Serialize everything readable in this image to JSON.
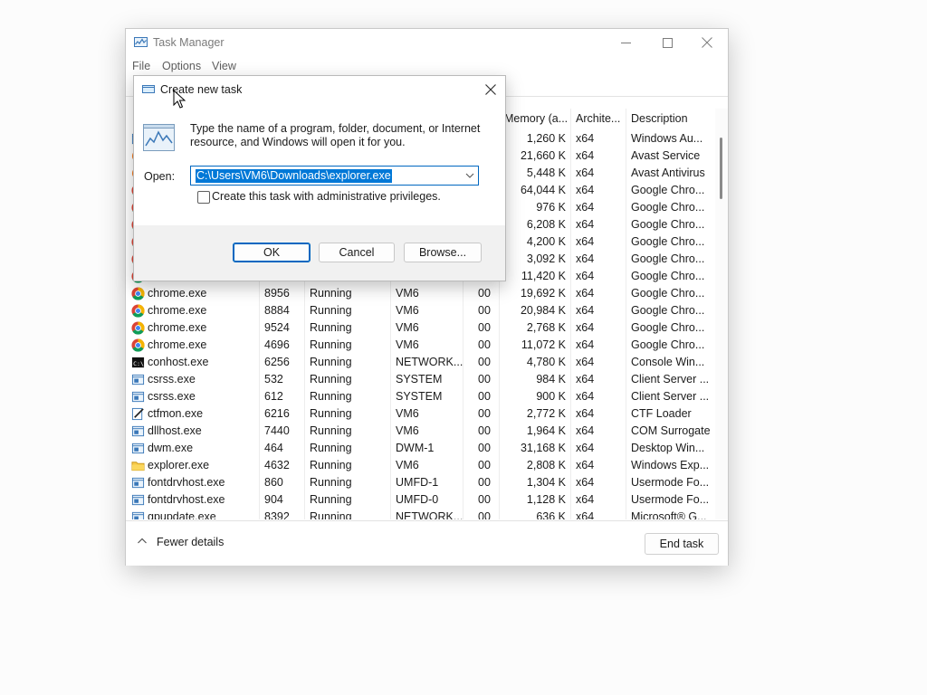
{
  "task_manager": {
    "title": "Task Manager",
    "icon": "task-manager-chart-icon",
    "menu": [
      "File",
      "Options",
      "View"
    ],
    "columns": [
      "Memory (a...",
      "Archite...",
      "Description"
    ],
    "rows": [
      {
        "name": "",
        "pid": "",
        "status": "",
        "user": "",
        "cpu": "",
        "memory": "1,260 K",
        "arch": "x64",
        "desc": "Windows Au...",
        "icon": "window-icon"
      },
      {
        "name": "",
        "pid": "",
        "status": "",
        "user": "",
        "cpu": "",
        "memory": "21,660 K",
        "arch": "x64",
        "desc": "Avast Service",
        "icon": "avast-icon"
      },
      {
        "name": "",
        "pid": "",
        "status": "",
        "user": "",
        "cpu": "",
        "memory": "5,448 K",
        "arch": "x64",
        "desc": "Avast Antivirus",
        "icon": "avast-icon"
      },
      {
        "name": "",
        "pid": "",
        "status": "",
        "user": "",
        "cpu": "",
        "memory": "64,044 K",
        "arch": "x64",
        "desc": "Google Chro...",
        "icon": "chrome-icon"
      },
      {
        "name": "",
        "pid": "",
        "status": "",
        "user": "",
        "cpu": "",
        "memory": "976 K",
        "arch": "x64",
        "desc": "Google Chro...",
        "icon": "chrome-icon"
      },
      {
        "name": "",
        "pid": "",
        "status": "",
        "user": "",
        "cpu": "",
        "memory": "6,208 K",
        "arch": "x64",
        "desc": "Google Chro...",
        "icon": "chrome-icon"
      },
      {
        "name": "",
        "pid": "",
        "status": "",
        "user": "",
        "cpu": "",
        "memory": "4,200 K",
        "arch": "x64",
        "desc": "Google Chro...",
        "icon": "chrome-icon"
      },
      {
        "name": "",
        "pid": "",
        "status": "",
        "user": "",
        "cpu": "",
        "memory": "3,092 K",
        "arch": "x64",
        "desc": "Google Chro...",
        "icon": "chrome-icon"
      },
      {
        "name": "",
        "pid": "",
        "status": "",
        "user": "",
        "cpu": "",
        "memory": "11,420 K",
        "arch": "x64",
        "desc": "Google Chro...",
        "icon": "chrome-icon"
      },
      {
        "name": "chrome.exe",
        "pid": "8956",
        "status": "Running",
        "user": "VM6",
        "cpu": "00",
        "memory": "19,692 K",
        "arch": "x64",
        "desc": "Google Chro...",
        "icon": "chrome-icon"
      },
      {
        "name": "chrome.exe",
        "pid": "8884",
        "status": "Running",
        "user": "VM6",
        "cpu": "00",
        "memory": "20,984 K",
        "arch": "x64",
        "desc": "Google Chro...",
        "icon": "chrome-icon"
      },
      {
        "name": "chrome.exe",
        "pid": "9524",
        "status": "Running",
        "user": "VM6",
        "cpu": "00",
        "memory": "2,768 K",
        "arch": "x64",
        "desc": "Google Chro...",
        "icon": "chrome-icon"
      },
      {
        "name": "chrome.exe",
        "pid": "4696",
        "status": "Running",
        "user": "VM6",
        "cpu": "00",
        "memory": "11,072 K",
        "arch": "x64",
        "desc": "Google Chro...",
        "icon": "chrome-icon"
      },
      {
        "name": "conhost.exe",
        "pid": "6256",
        "status": "Running",
        "user": "NETWORK...",
        "cpu": "00",
        "memory": "4,780 K",
        "arch": "x64",
        "desc": "Console Win...",
        "icon": "console-icon"
      },
      {
        "name": "csrss.exe",
        "pid": "532",
        "status": "Running",
        "user": "SYSTEM",
        "cpu": "00",
        "memory": "984 K",
        "arch": "x64",
        "desc": "Client Server ...",
        "icon": "window-icon"
      },
      {
        "name": "csrss.exe",
        "pid": "612",
        "status": "Running",
        "user": "SYSTEM",
        "cpu": "00",
        "memory": "900 K",
        "arch": "x64",
        "desc": "Client Server ...",
        "icon": "window-icon"
      },
      {
        "name": "ctfmon.exe",
        "pid": "6216",
        "status": "Running",
        "user": "VM6",
        "cpu": "00",
        "memory": "2,772 K",
        "arch": "x64",
        "desc": "CTF Loader",
        "icon": "pen-note-icon"
      },
      {
        "name": "dllhost.exe",
        "pid": "7440",
        "status": "Running",
        "user": "VM6",
        "cpu": "00",
        "memory": "1,964 K",
        "arch": "x64",
        "desc": "COM Surrogate",
        "icon": "window-icon"
      },
      {
        "name": "dwm.exe",
        "pid": "464",
        "status": "Running",
        "user": "DWM-1",
        "cpu": "00",
        "memory": "31,168 K",
        "arch": "x64",
        "desc": "Desktop Win...",
        "icon": "window-icon"
      },
      {
        "name": "explorer.exe",
        "pid": "4632",
        "status": "Running",
        "user": "VM6",
        "cpu": "00",
        "memory": "2,808 K",
        "arch": "x64",
        "desc": "Windows Exp...",
        "icon": "folder-icon"
      },
      {
        "name": "fontdrvhost.exe",
        "pid": "860",
        "status": "Running",
        "user": "UMFD-1",
        "cpu": "00",
        "memory": "1,304 K",
        "arch": "x64",
        "desc": "Usermode Fo...",
        "icon": "window-icon"
      },
      {
        "name": "fontdrvhost.exe",
        "pid": "904",
        "status": "Running",
        "user": "UMFD-0",
        "cpu": "00",
        "memory": "1,128 K",
        "arch": "x64",
        "desc": "Usermode Fo...",
        "icon": "window-icon"
      },
      {
        "name": "gpupdate.exe",
        "pid": "8392",
        "status": "Running",
        "user": "NETWORK...",
        "cpu": "00",
        "memory": "636 K",
        "arch": "x64",
        "desc": "Microsoft® G...",
        "icon": "window-icon"
      }
    ],
    "footer": {
      "fewer_details": "Fewer details",
      "end_task": "End task"
    }
  },
  "dialog": {
    "title": "Create new task",
    "description": "Type the name of a program, folder, document, or Internet resource, and Windows will open it for you.",
    "open_label": "Open:",
    "open_value": "C:\\Users\\VM6\\Downloads\\explorer.exe",
    "admin_label": "Create this task with administrative privileges.",
    "admin_checked": false,
    "ok": "OK",
    "cancel": "Cancel",
    "browse": "Browse..."
  },
  "colors": {
    "accent": "#0067c0",
    "selection": "#0078d7",
    "chrome_red": "#db4437",
    "chrome_green": "#0f9d58",
    "chrome_yellow": "#f4b400",
    "chrome_blue": "#4285f4",
    "avast_orange": "#f47b20"
  }
}
